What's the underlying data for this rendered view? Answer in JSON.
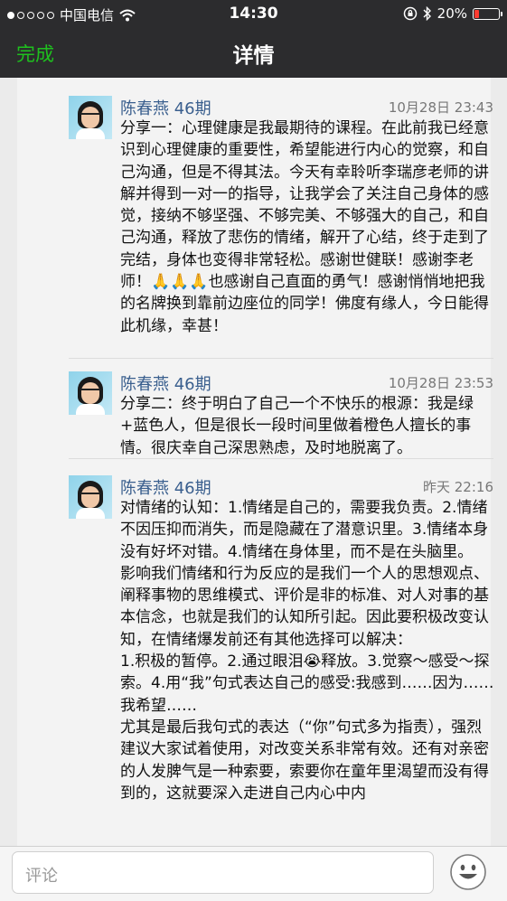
{
  "status_bar": {
    "carrier": "中国电信",
    "time": "14:30",
    "battery": "20%",
    "battery_level": 0.2,
    "signal_dots_filled": 1,
    "signal_dots_total": 5
  },
  "nav": {
    "done_label": "完成",
    "title": "详情"
  },
  "entries": [
    {
      "name": "陈春燕 46期",
      "time": "10月28日 23:43",
      "text": "分享一：心理健康是我最期待的课程。在此前我已经意识到心理健康的重要性，希望能进行内心的觉察，和自己沟通，但是不得其法。今天有幸聆听李瑞彦老师的讲解并得到一对一的指导，让我学会了关注自己身体的感觉，接纳不够坚强、不够完美、不够强大的自己，和自己沟通，释放了悲伤的情绪，解开了心结，终于走到了完结，身体也变得非常轻松。感谢世健联！感谢李老师！🙏🙏🙏也感谢自己直面的勇气！感谢悄悄地把我的名牌换到靠前边座位的同学！佛度有缘人，今日能得此机缘，幸甚！"
    },
    {
      "name": "陈春燕 46期",
      "time": "10月28日 23:53",
      "text": "分享二：终于明白了自己一个不快乐的根源：我是绿+蓝色人，但是很长一段时间里做着橙色人擅长的事情。很庆幸自己深思熟虑，及时地脱离了。"
    },
    {
      "name": "陈春燕 46期",
      "time": "昨天 22:16",
      "text": "对情绪的认知：1.情绪是自己的，需要我负责。2.情绪不因压抑而消失，而是隐藏在了潜意识里。3.情绪本身没有好坏对错。4.情绪在身体里，而不是在头脑里。\n影响我们情绪和行为反应的是我们一个人的思想观点、阐释事物的思维模式、评价是非的标准、对人对事的基本信念，也就是我们的认知所引起。因此要积极改变认知，在情绪爆发前还有其他选择可以解决：\n1.积极的暂停。2.通过眼泪😭释放。3.觉察～感受～探索。4.用“我”句式表达自己的感受:我感到……因为……我希望……\n尤其是最后我句式的表达（“你”句式多为指责），强烈建议大家试着使用，对改变关系非常有效。还有对亲密的人发脾气是一种索要，索要你在童年里渴望而没有得到的，这就要深入走进自己内心中内"
    }
  ],
  "comment_bar": {
    "placeholder": "评论",
    "emoji_icon": "smiley-face-icon"
  }
}
